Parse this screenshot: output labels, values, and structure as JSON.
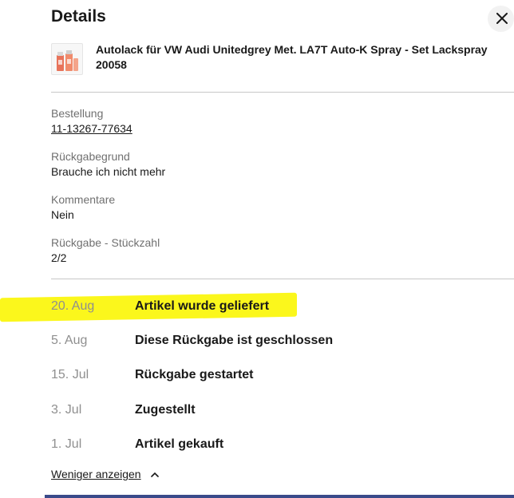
{
  "header": {
    "title": "Details"
  },
  "item": {
    "title": "Autolack für VW Audi Unitedgrey Met. LA7T Auto-K Spray - Set Lackspray 20058",
    "thumbnail_icon": "product-thumbnail"
  },
  "fields": [
    {
      "label": "Bestellung",
      "value": "11-13267-77634"
    },
    {
      "label": "Rückgabegrund",
      "value": "Brauche ich nicht mehr"
    },
    {
      "label": "Kommentare",
      "value": "Nein"
    },
    {
      "label": "Rückgabe - Stückzahl",
      "value": "2/2"
    }
  ],
  "timeline": [
    {
      "date": "20. Aug",
      "event": "Artikel wurde geliefert"
    },
    {
      "date": "5. Aug",
      "event": "Diese Rückgabe ist geschlossen"
    },
    {
      "date": "15. Jul",
      "event": "Rückgabe gestartet"
    },
    {
      "date": "3. Jul",
      "event": "Zugestellt"
    },
    {
      "date": "1. Jul",
      "event": "Artikel gekauft"
    }
  ],
  "footer": {
    "show_less_label": "Weniger anzeigen",
    "show_less_icon": "chevron-up-icon"
  },
  "colors": {
    "highlight": "#fbf71c",
    "muted_text": "#707070",
    "date_text": "#8f8f8f",
    "divider": "#c7c7c7"
  }
}
